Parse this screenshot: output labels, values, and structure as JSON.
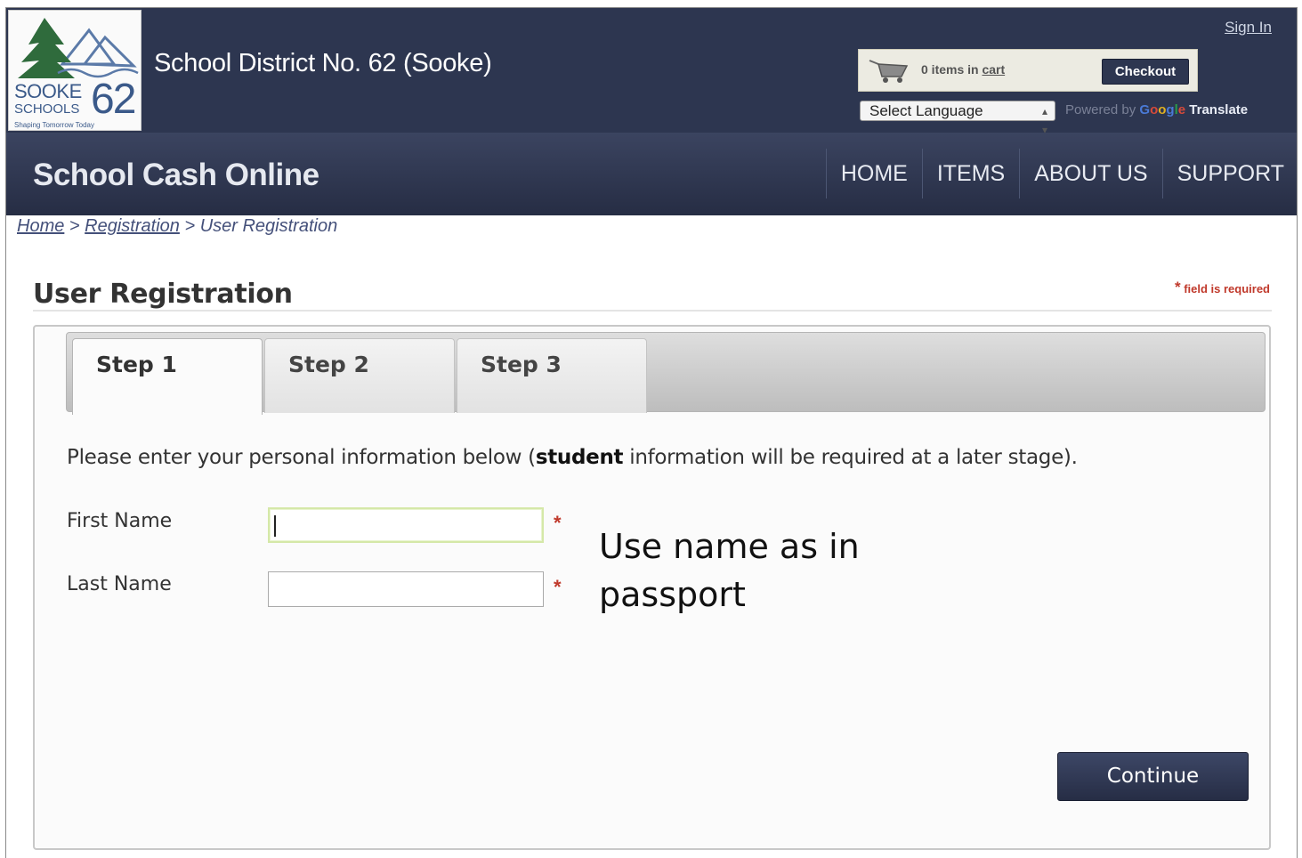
{
  "header": {
    "logo": {
      "line1": "SOOKE",
      "line2": "SCHOOLS",
      "number": "62",
      "tagline": "Shaping Tomorrow Today"
    },
    "district_title": "School District No. 62 (Sooke)",
    "sign_in": "Sign In",
    "cart": {
      "icon": "shopping-cart-icon",
      "text_prefix": "0 items in ",
      "link": "cart",
      "checkout_label": "Checkout"
    },
    "language": {
      "selected": "Select Language",
      "powered_by": "Powered by",
      "google": [
        "G",
        "o",
        "o",
        "g",
        "l",
        "e"
      ],
      "translate": "Translate"
    }
  },
  "nav": {
    "brand": "School Cash Online",
    "items": [
      {
        "label": "HOME"
      },
      {
        "label": "ITEMS"
      },
      {
        "label": "ABOUT US"
      },
      {
        "label": "SUPPORT"
      }
    ]
  },
  "breadcrumb": {
    "home": "Home",
    "sep": ">",
    "registration": "Registration",
    "current": "User Registration"
  },
  "page": {
    "title": "User Registration",
    "required_note": "field is required",
    "required_star": "*"
  },
  "tabs": [
    {
      "label": "Step 1",
      "active": true
    },
    {
      "label": "Step 2",
      "active": false
    },
    {
      "label": "Step 3",
      "active": false
    }
  ],
  "form": {
    "intro_before": "Please enter your personal information below (",
    "intro_bold": "student",
    "intro_after": " information will be required at a later stage).",
    "first_name": {
      "label": "First Name",
      "value": ""
    },
    "last_name": {
      "label": "Last Name",
      "value": ""
    },
    "continue_label": "Continue"
  },
  "annotation": {
    "line1": "Use name as in",
    "line2": "passport"
  },
  "colors": {
    "header_bg": "#2d3650",
    "required_red": "#c0392b",
    "focus_border": "#d5e8a8"
  }
}
